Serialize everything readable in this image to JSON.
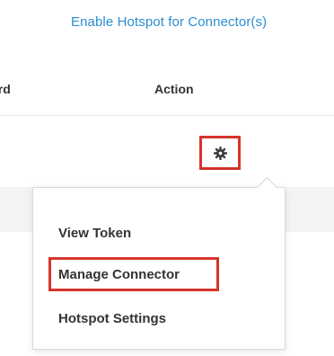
{
  "colors": {
    "accent": "#2a8fd0",
    "highlight": "#d5342b",
    "gear": "#3a3a3a"
  },
  "header": {
    "enable_hotspot_link": "Enable Hotspot for Connector(s)"
  },
  "table": {
    "columns": [
      "ard",
      "Action"
    ]
  },
  "row": {
    "action_icon": "gear-icon"
  },
  "action_menu": {
    "items": [
      {
        "label": "View Token",
        "highlighted": false
      },
      {
        "label": "Manage Connector",
        "highlighted": true
      },
      {
        "label": "Hotspot Settings",
        "highlighted": false
      }
    ]
  }
}
